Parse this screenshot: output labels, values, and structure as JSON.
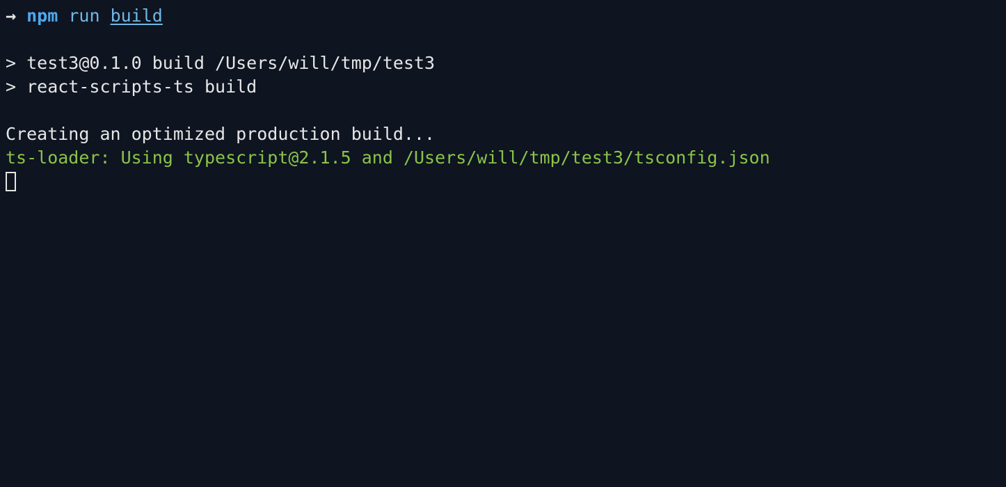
{
  "prompt": {
    "arrow": "→",
    "cmd1": "npm",
    "cmd2": "run",
    "cmd3": "build"
  },
  "output": {
    "line1": "> test3@0.1.0 build /Users/will/tmp/test3",
    "line2": "> react-scripts-ts build",
    "line3": "Creating an optimized production build...",
    "line4": "ts-loader: Using typescript@2.1.5 and /Users/will/tmp/test3/tsconfig.json"
  }
}
